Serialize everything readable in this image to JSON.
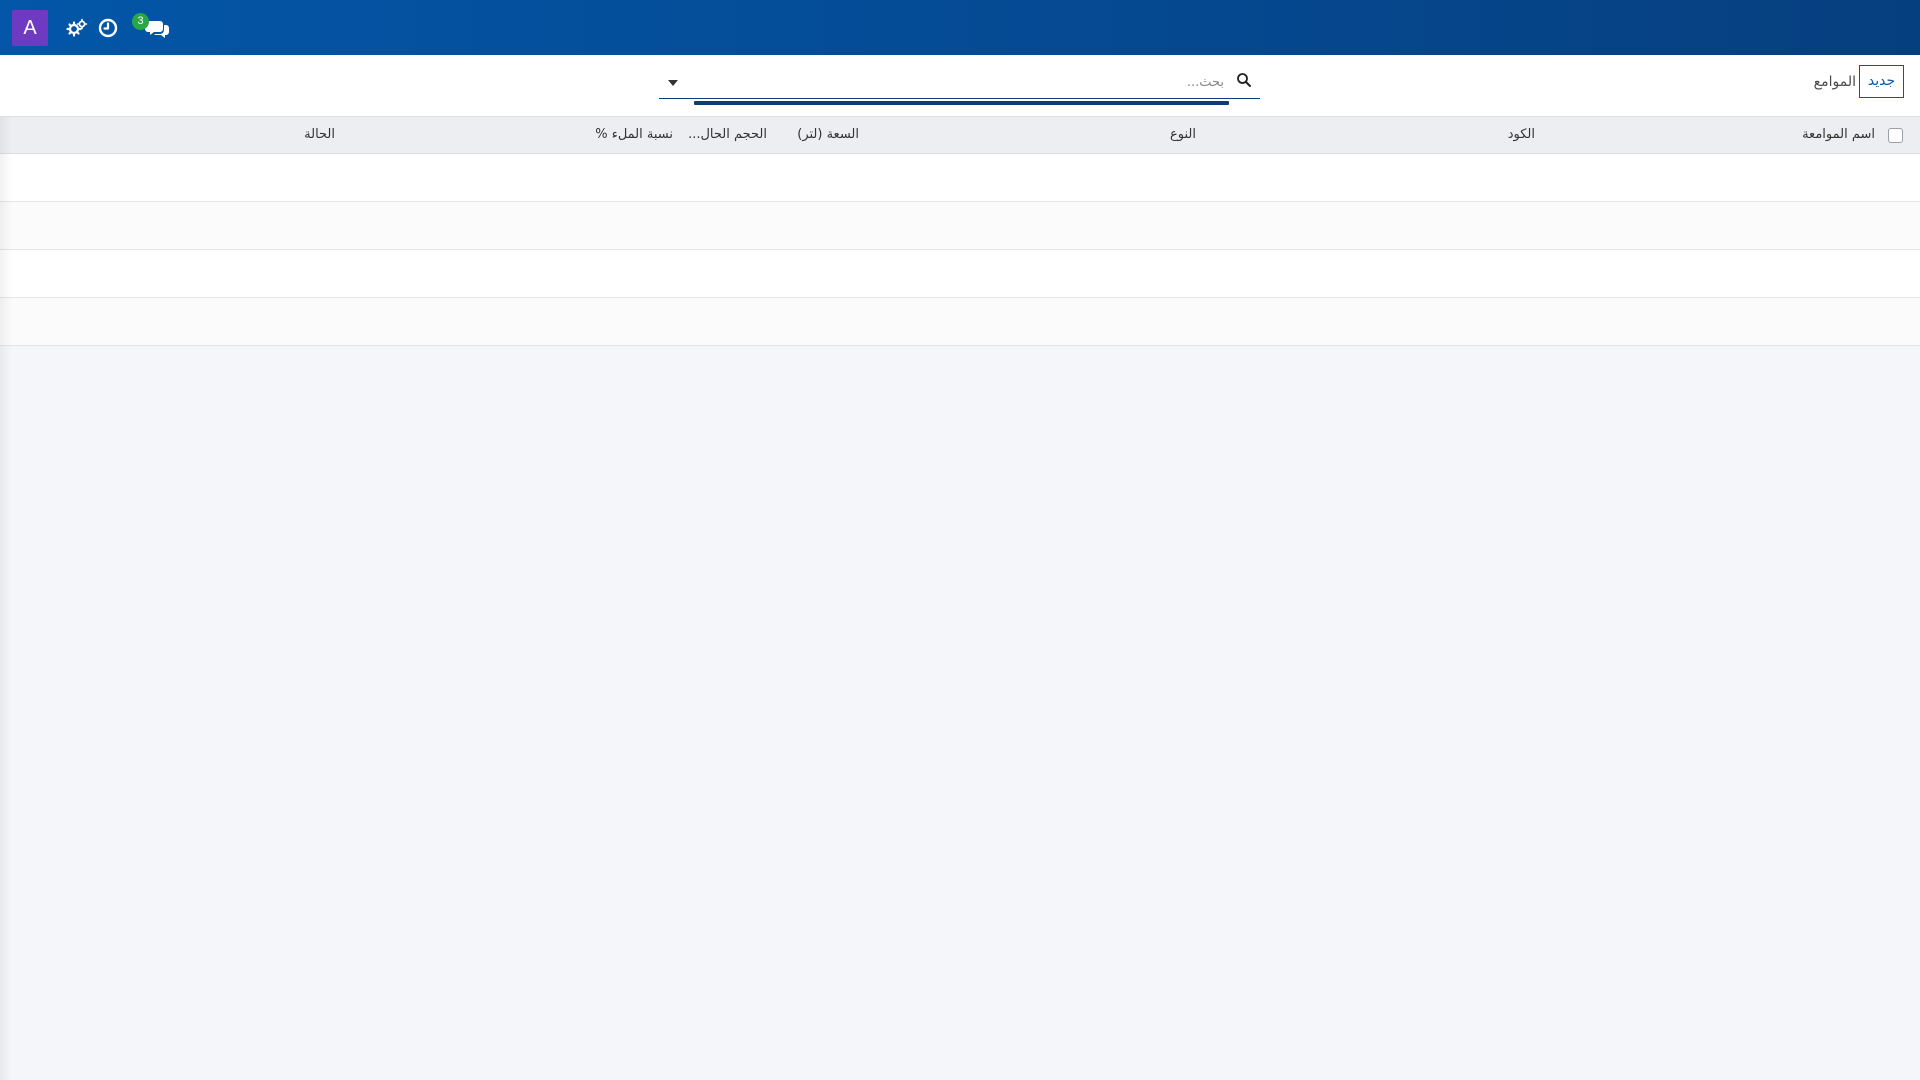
{
  "navbar": {
    "avatar_letter": "A",
    "icons": [
      "cogs-icon",
      "clock-icon",
      "comments-icon"
    ],
    "messages_badge": "3",
    "background": "#0356a8",
    "avatar_color": "#6f3ac2",
    "badge_color": "#28a745"
  },
  "control_panel": {
    "new_button_label": "جديد",
    "title": "الموامع",
    "search": {
      "placeholder": "بحث...",
      "value": ""
    }
  },
  "table": {
    "columns": [
      "اسم الموامعة",
      "الكود",
      "النوع",
      "السعة (لتر)",
      "الحجم الحال...",
      "نسبة الملء %",
      "الحالة"
    ],
    "rows": [
      {},
      {},
      {},
      {}
    ]
  }
}
